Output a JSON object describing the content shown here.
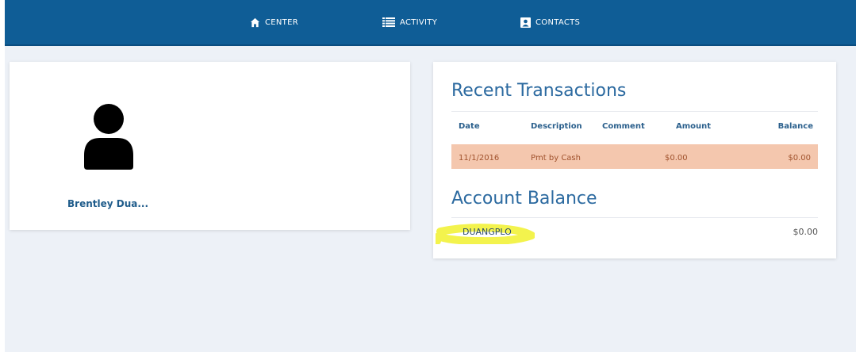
{
  "nav": {
    "center_label": "CENTER",
    "activity_label": "ACTIVITY",
    "contacts_label": "CONTACTS"
  },
  "profile": {
    "name": "Brentley Dua..."
  },
  "transactions": {
    "title": "Recent Transactions",
    "columns": [
      "Date",
      "Description",
      "Comment",
      "Amount",
      "Balance"
    ],
    "rows": [
      {
        "date": "11/1/2016",
        "description": "Pmt by Cash",
        "comment": "",
        "amount": "$0.00",
        "balance": "$0.00"
      }
    ]
  },
  "account_balance": {
    "title": "Account Balance",
    "account_name": "DUANGPLO",
    "amount": "$0.00"
  },
  "colors": {
    "navbar": "#0f5d96",
    "accent": "#2c6aa0",
    "row_highlight": "#f4c7ae",
    "marker": "#f2f23a"
  }
}
